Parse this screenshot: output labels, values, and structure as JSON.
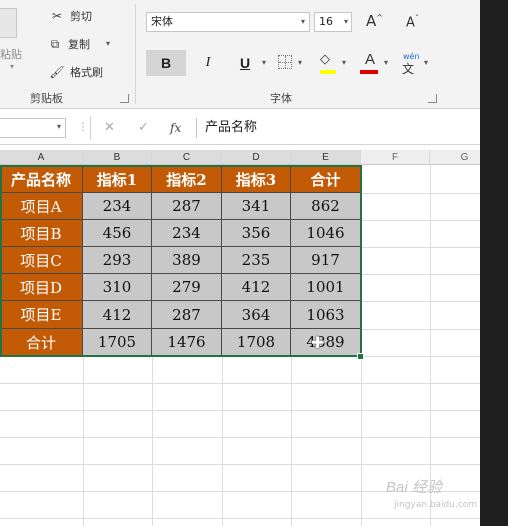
{
  "ribbon": {
    "clipboard": {
      "paste_label": "粘贴",
      "cut_label": "剪切",
      "copy_label": "复制",
      "format_painter_label": "格式刷",
      "group_label": "剪贴板"
    },
    "font": {
      "font_name": "宋体",
      "font_size": "16",
      "grow_label": "A",
      "shrink_label": "A",
      "bold_label": "B",
      "italic_label": "I",
      "underline_label": "U",
      "fontcolor_label": "A",
      "phonetic_label": "文",
      "phonetic_top": "wén",
      "group_label": "字体",
      "fill_color": "#ffff00",
      "font_color": "#e00000"
    }
  },
  "formula_bar": {
    "fx_label": "fx",
    "content": "产品名称"
  },
  "columns": [
    "A",
    "B",
    "C",
    "D",
    "E",
    "F",
    "G"
  ],
  "table": {
    "headers": [
      "产品名称",
      "指标1",
      "指标2",
      "指标3",
      "合计"
    ],
    "rows": [
      [
        "项目A",
        "234",
        "287",
        "341",
        "862"
      ],
      [
        "项目B",
        "456",
        "234",
        "356",
        "1046"
      ],
      [
        "项目C",
        "293",
        "389",
        "235",
        "917"
      ],
      [
        "项目D",
        "310",
        "279",
        "412",
        "1001"
      ],
      [
        "项目E",
        "412",
        "287",
        "364",
        "1063"
      ],
      [
        "合计",
        "1705",
        "1476",
        "1708",
        "4889"
      ]
    ],
    "header_color": "#c25a06",
    "value_fill": "#c8c8c8",
    "selection_color": "#217346"
  },
  "watermark": {
    "main": "Bai 经验",
    "sub": "jingyan.baidu.com"
  }
}
